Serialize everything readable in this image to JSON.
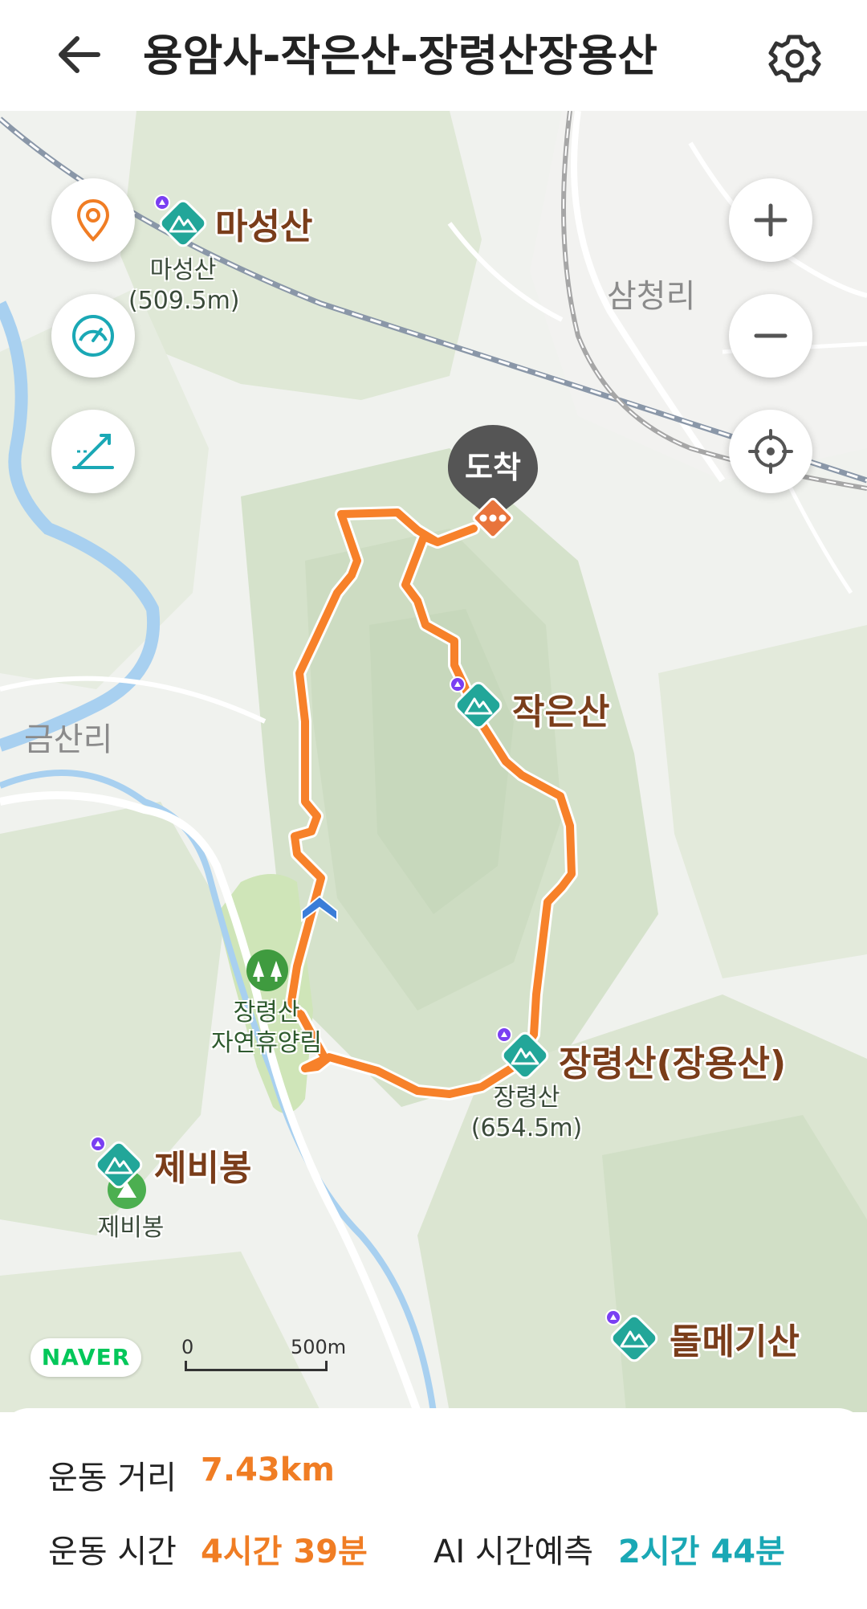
{
  "header": {
    "title": "용암사-작은산-장령산장용산",
    "back_icon": "back-arrow-icon",
    "settings_icon": "gear-icon"
  },
  "map": {
    "arrival_label": "도착",
    "town_labels": {
      "samcheong": "삼청리",
      "geumsan": "금산리"
    },
    "peaks": {
      "maseong": {
        "name": "마성산",
        "sub_name": "마성산",
        "sub_height": "(509.5m)"
      },
      "jageun": {
        "name": "작은산"
      },
      "jangryeong": {
        "name": "장령산(장용산)",
        "sub_name": "장령산",
        "sub_height": "(654.5m)"
      },
      "jebi": {
        "name": "제비봉",
        "sub_name": "제비봉"
      },
      "dolmegi": {
        "name": "돌메기산"
      }
    },
    "forest": {
      "line1": "장령산",
      "line2": "자연휴양림"
    },
    "logo": "NAVER",
    "scale": {
      "zero": "0",
      "distance": "500m"
    },
    "controls": [
      "location-pin-icon",
      "speedometer-icon",
      "slope-icon",
      "zoom-in-icon",
      "zoom-out-icon",
      "gps-target-icon"
    ],
    "route_color": "#f7812a",
    "peak_color": "#22a699"
  },
  "stats": {
    "distance_label": "운동 거리",
    "distance_value": "7.43km",
    "time_label": "운동 시간",
    "time_value": "4시간 39분",
    "ai_label": "AI 시간예측",
    "ai_value": "2시간 44분"
  }
}
